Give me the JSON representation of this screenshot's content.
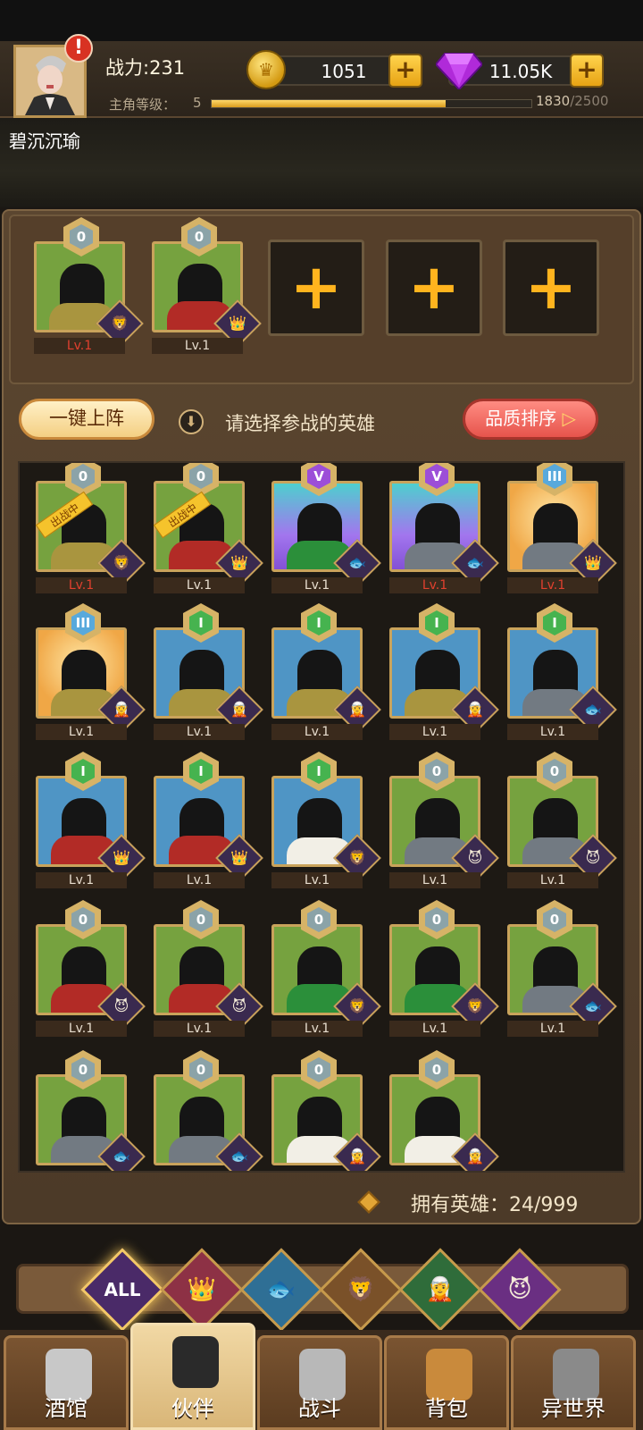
{
  "header": {
    "power": "战力:231",
    "level_label": "主角等级：",
    "level_value": "5",
    "xp_current": "1830",
    "xp_max": "/2500",
    "xp_fraction": 0.732,
    "coins": "1051",
    "gems": "11.05K",
    "player_name": "碧沉沉瑜",
    "alert": "!"
  },
  "team": {
    "slots": [
      {
        "rank": "0",
        "level": "Lv.1",
        "level_color": "red"
      },
      {
        "rank": "0",
        "level": "Lv.1",
        "level_color": "normal"
      },
      {
        "empty": true,
        "plus": "+"
      },
      {
        "empty": true,
        "plus": "+"
      },
      {
        "empty": true,
        "plus": "+"
      }
    ]
  },
  "actions": {
    "onekey_label": "一键上阵",
    "hint": "请选择参战的英雄",
    "sort_label": "品质排序",
    "sort_arrow": "▷",
    "info_icon": "⬇"
  },
  "heroes": [
    {
      "rank": "0",
      "bg": "green",
      "level": "Lv.1",
      "red": true,
      "tag": "出战中",
      "faction": "🦁",
      "body": "gold-body"
    },
    {
      "rank": "0",
      "bg": "green",
      "level": "Lv.1",
      "red": false,
      "tag": "出战中",
      "faction": "👑",
      "body": "red-body"
    },
    {
      "rank": "V",
      "bg": "purple",
      "level": "Lv.1",
      "red": false,
      "faction": "🐟",
      "body": "green-body"
    },
    {
      "rank": "V",
      "bg": "purple",
      "level": "Lv.1",
      "red": true,
      "faction": "🐟",
      "body": "grey-body"
    },
    {
      "rank": "III",
      "bg": "orange",
      "level": "Lv.1",
      "red": true,
      "faction": "👑",
      "body": "grey-body"
    },
    {
      "rank": "III",
      "bg": "orange",
      "level": "Lv.1",
      "red": false,
      "faction": "🧝",
      "body": "gold-body"
    },
    {
      "rank": "I",
      "bg": "blue",
      "level": "Lv.1",
      "red": false,
      "faction": "🧝",
      "body": "gold-body"
    },
    {
      "rank": "I",
      "bg": "blue",
      "level": "Lv.1",
      "red": false,
      "faction": "🧝",
      "body": "gold-body"
    },
    {
      "rank": "I",
      "bg": "blue",
      "level": "Lv.1",
      "red": false,
      "faction": "🧝",
      "body": "gold-body"
    },
    {
      "rank": "I",
      "bg": "blue",
      "level": "Lv.1",
      "red": false,
      "faction": "🐟",
      "body": "grey-body"
    },
    {
      "rank": "I",
      "bg": "blue",
      "level": "Lv.1",
      "red": false,
      "faction": "👑",
      "body": "red-body"
    },
    {
      "rank": "I",
      "bg": "blue",
      "level": "Lv.1",
      "red": false,
      "faction": "👑",
      "body": "red-body"
    },
    {
      "rank": "I",
      "bg": "blue",
      "level": "Lv.1",
      "red": false,
      "faction": "🦁",
      "body": "white-body"
    },
    {
      "rank": "0",
      "bg": "green",
      "level": "Lv.1",
      "red": false,
      "faction": "😈",
      "body": "grey-body"
    },
    {
      "rank": "0",
      "bg": "green",
      "level": "Lv.1",
      "red": false,
      "faction": "😈",
      "body": "grey-body"
    },
    {
      "rank": "0",
      "bg": "green",
      "level": "Lv.1",
      "red": false,
      "faction": "😈",
      "body": "red-body"
    },
    {
      "rank": "0",
      "bg": "green",
      "level": "Lv.1",
      "red": false,
      "faction": "😈",
      "body": "red-body"
    },
    {
      "rank": "0",
      "bg": "green",
      "level": "Lv.1",
      "red": false,
      "faction": "🦁",
      "body": "green-body"
    },
    {
      "rank": "0",
      "bg": "green",
      "level": "Lv.1",
      "red": false,
      "faction": "🦁",
      "body": "green-body"
    },
    {
      "rank": "0",
      "bg": "green",
      "level": "Lv.1",
      "red": false,
      "faction": "🐟",
      "body": "grey-body"
    },
    {
      "rank": "0",
      "bg": "green",
      "level": "",
      "red": false,
      "faction": "🐟",
      "body": "grey-body"
    },
    {
      "rank": "0",
      "bg": "green",
      "level": "",
      "red": false,
      "faction": "🐟",
      "body": "grey-body"
    },
    {
      "rank": "0",
      "bg": "green",
      "level": "",
      "red": false,
      "faction": "🧝",
      "body": "white-body"
    },
    {
      "rank": "0",
      "bg": "green",
      "level": "",
      "red": false,
      "faction": "🧝",
      "body": "white-body"
    }
  ],
  "owned": "拥有英雄：24/999",
  "filters": [
    {
      "id": "all",
      "label": "ALL",
      "color": "#4a2a68"
    },
    {
      "id": "crown",
      "label": "👑",
      "color": "#8d3145"
    },
    {
      "id": "fish",
      "label": "🐟",
      "color": "#2f6f95"
    },
    {
      "id": "lion",
      "label": "🦁",
      "color": "#7a5129"
    },
    {
      "id": "elf",
      "label": "🧝",
      "color": "#2f6c3a"
    },
    {
      "id": "demon",
      "label": "😈",
      "color": "#6a2f82"
    }
  ],
  "nav": [
    {
      "label": "酒馆",
      "icon": "beer-mug-icon"
    },
    {
      "label": "伙伴",
      "icon": "companion-icon",
      "active": true
    },
    {
      "label": "战斗",
      "icon": "crossed-swords-icon"
    },
    {
      "label": "背包",
      "icon": "treasure-chest-icon"
    },
    {
      "label": "异世界",
      "icon": "portal-icon"
    }
  ]
}
